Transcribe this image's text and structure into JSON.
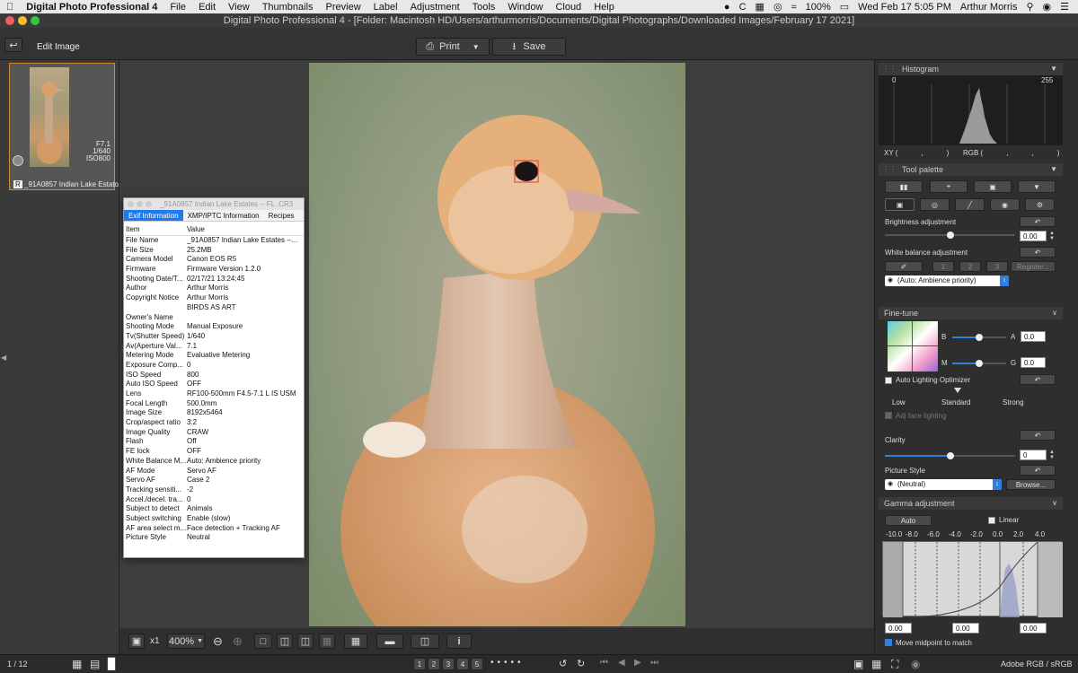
{
  "menubar": {
    "app": "Digital Photo Professional 4",
    "items": [
      "File",
      "Edit",
      "View",
      "Thumbnails",
      "Preview",
      "Label",
      "Adjustment",
      "Tools",
      "Window",
      "Cloud",
      "Help"
    ],
    "battery": "100%",
    "clock": "Wed Feb 17  5:05 PM",
    "user": "Arthur Morris"
  },
  "window": {
    "title": "Digital Photo Professional 4 - [Folder: Macintosh HD/Users/arthurmorris/Documents/Digital Photographs/Downloaded Images/February 17 2021]"
  },
  "toolbar": {
    "edit_image": "Edit Image",
    "print": "Print",
    "save": "Save"
  },
  "thumbnail": {
    "aperture": "F7.1",
    "shutter": "1/640",
    "iso": "ISO800",
    "badge": "R",
    "filename": "_91A0857  Indian Lake Estato..."
  },
  "exif": {
    "window_title": "_91A0857  Indian Lake Estates -- FL .CR3",
    "tabs": [
      "Exif Information",
      "XMP/IPTC Information",
      "Recipes"
    ],
    "col_item": "Item",
    "col_value": "Value",
    "rows": [
      [
        "File Name",
        "_91A0857  Indian Lake Estates --..."
      ],
      [
        "File Size",
        "25.2MB"
      ],
      [
        "Camera Model",
        "Canon EOS R5"
      ],
      [
        "Firmware",
        "Firmware Version 1.2.0"
      ],
      [
        "Shooting Date/T...",
        "02/17/21 13:24:45"
      ],
      [
        "Author",
        "Arthur Morris"
      ],
      [
        "Copyright Notice",
        "Arthur Morris"
      ],
      [
        "",
        "BIRDS AS ART"
      ],
      [
        "Owner's Name",
        ""
      ],
      [
        "Shooting Mode",
        "Manual Exposure"
      ],
      [
        "Tv(Shutter Speed)",
        "1/640"
      ],
      [
        "Av(Aperture Val...",
        "7.1"
      ],
      [
        "Metering Mode",
        "Evaluative Metering"
      ],
      [
        "Exposure Comp...",
        "0"
      ],
      [
        "ISO Speed",
        "800"
      ],
      [
        "Auto ISO Speed",
        "OFF"
      ],
      [
        "Lens",
        "RF100-500mm F4.5-7.1 L IS USM"
      ],
      [
        "Focal Length",
        "500.0mm"
      ],
      [
        "Image Size",
        "8192x5464"
      ],
      [
        "Crop/aspect ratio",
        "3:2"
      ],
      [
        "Image Quality",
        "CRAW"
      ],
      [
        "Flash",
        "Off"
      ],
      [
        "FE lock",
        "OFF"
      ],
      [
        "White Balance M...",
        "Auto: Ambience priority"
      ],
      [
        "AF Mode",
        "Servo AF"
      ],
      [
        "Servo AF",
        "Case 2"
      ],
      [
        "Tracking sensiti...",
        "-2"
      ],
      [
        "Accel./decel. tra...",
        "0"
      ],
      [
        "Subject to detect",
        "Animals"
      ],
      [
        "Subject switching",
        "Enable (slow)"
      ],
      [
        "AF area select m...",
        "Face detection + Tracking AF"
      ],
      [
        "Picture Style",
        "Neutral"
      ]
    ]
  },
  "view": {
    "x1": "x1",
    "zoom": "400%"
  },
  "status": {
    "count": "1 / 12",
    "ratings": [
      "1",
      "2",
      "3",
      "4",
      "5"
    ],
    "colorspace": "Adobe RGB / sRGB"
  },
  "histogram": {
    "title": "Histogram",
    "min": "0",
    "max": "255",
    "xy_label": "XY (",
    "xy_sep": ",",
    "xy_close": ")",
    "rgb_label": "RGB (",
    "rgb_seps": [
      ",",
      ","
    ],
    "rgb_close": ")"
  },
  "palette": {
    "title": "Tool palette",
    "brightness_label": "Brightness adjustment",
    "brightness_value": "0.00",
    "brightness_level": 0.5,
    "wb_label": "White balance adjustment",
    "wb_slots": [
      "1",
      "2",
      "3"
    ],
    "register": "Register...",
    "wb_select": "(Auto: Ambience priority)"
  },
  "finetune": {
    "title": "Fine-tune",
    "b": "B",
    "a": "A",
    "m": "M",
    "g": "G",
    "ba_value": "0.0",
    "mg_value": "0.0",
    "alo_label": "Auto Lighting Optimizer",
    "alo_levels": [
      "Low",
      "Standard",
      "Strong"
    ],
    "adj_face": "Adj face lighting",
    "clarity_label": "Clarity",
    "clarity_value": "0",
    "clarity_level": 0.5,
    "style_label": "Picture Style",
    "style_select": "(Neutral)",
    "browse": "Browse..."
  },
  "gamma": {
    "title": "Gamma adjustment",
    "auto": "Auto",
    "linear": "Linear",
    "ticks": [
      "-10.0",
      "-8.0",
      "-6.0",
      "-4.0",
      "-2.0",
      "0.0",
      "2.0",
      "4.0"
    ],
    "val_left": "0.00",
    "val_mid": "0.00",
    "val_right": "0.00",
    "midpoint": "Move midpoint to match"
  },
  "colors": {
    "accent": "#2f7fe0",
    "thumb_border": "#c98a3a"
  }
}
